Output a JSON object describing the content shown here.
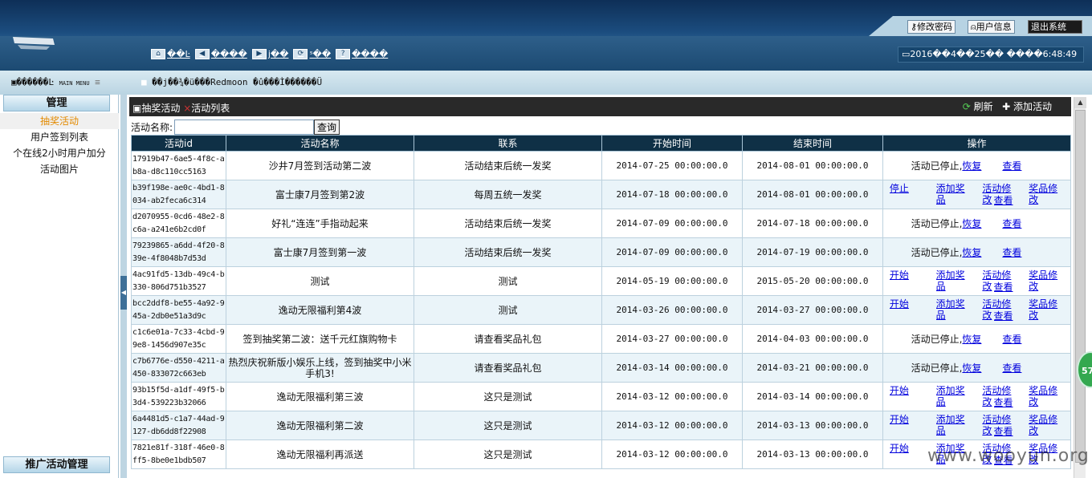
{
  "header": {
    "change_password": "修改密码",
    "user_info": "用户信息",
    "logout": "退出系统",
    "nav": [
      {
        "icon": "home-icon",
        "label": "��Ŀ"
      },
      {
        "icon": "back-icon",
        "label": "����"
      },
      {
        "icon": "forward-icon",
        "label": "j��"
      },
      {
        "icon": "refresh-icon",
        "label": "ˢ��"
      },
      {
        "icon": "help-icon",
        "label": "����"
      }
    ],
    "clock": "2016��4��25�� ����6:48:49"
  },
  "subheader": {
    "menu_title": "������Ŀ",
    "menu_sub": "MAIN MENU",
    "notice": "��j��¾�ü���Redmoon  �û���Ì������Ü"
  },
  "sidebar": {
    "section1": "管理",
    "items": [
      "抽奖活动",
      "用户签到列表",
      "个在线2小时用户加分",
      "活动图片"
    ],
    "section2": "推广活动管理"
  },
  "main": {
    "breadcrumb_module": "抽奖活动",
    "breadcrumb_page": "活动列表",
    "refresh": "刷新",
    "add": "添加活动",
    "search_label": "活动名称:",
    "search_value": "",
    "search_button": "查询",
    "columns": [
      "活动id",
      "活动名称",
      "联系",
      "开始时间",
      "结束时间",
      "操作"
    ],
    "rows": [
      {
        "id": "17919b47-6ae5-4f8c-ab8a-d8c110cc5163",
        "name": "沙井7月签到活动第二波",
        "contact": "活动结束后统一发奖",
        "start": "2014-07-25 00:00:00.0",
        "end": "2014-08-01 00:00:00.0",
        "status": "活动已停止,",
        "ops": [
          "恢复",
          "查看"
        ]
      },
      {
        "id": "b39f198e-ae0c-4bd1-8034-ab2feca6c314",
        "name": "富士康7月签到第2波",
        "contact": "每周五统一发奖",
        "start": "2014-07-18 00:00:00.0",
        "end": "2014-08-01 00:00:00.0",
        "status": "",
        "ops": [
          "停止",
          "添加奖品",
          "活动修改",
          "奖品修改",
          "查看"
        ]
      },
      {
        "id": "d2070955-0cd6-48e2-8c6a-a241e6b2cd0f",
        "name": "好礼“连连”手指动起来",
        "contact": "活动结束后统一发奖",
        "start": "2014-07-09 00:00:00.0",
        "end": "2014-07-18 00:00:00.0",
        "status": "活动已停止,",
        "ops": [
          "恢复",
          "查看"
        ]
      },
      {
        "id": "79239865-a6dd-4f20-839e-4f8048b7d53d",
        "name": "富士康7月签到第一波",
        "contact": "活动结束后统一发奖",
        "start": "2014-07-09 00:00:00.0",
        "end": "2014-07-19 00:00:00.0",
        "status": "活动已停止,",
        "ops": [
          "恢复",
          "查看"
        ]
      },
      {
        "id": "4ac91fd5-13db-49c4-b330-806d751b3527",
        "name": "测试",
        "contact": "测试",
        "start": "2014-05-19 00:00:00.0",
        "end": "2015-05-20 00:00:00.0",
        "status": "",
        "ops": [
          "开始",
          "添加奖品",
          "活动修改",
          "奖品修改",
          "查看"
        ]
      },
      {
        "id": "bcc2ddf8-be55-4a92-945a-2db0e51a3d9c",
        "name": "逸动无限福利第4波",
        "contact": "测试",
        "start": "2014-03-26 00:00:00.0",
        "end": "2014-03-27 00:00:00.0",
        "status": "",
        "ops": [
          "开始",
          "添加奖品",
          "活动修改",
          "奖品修改",
          "查看"
        ]
      },
      {
        "id": "c1c6e01a-7c33-4cbd-99e8-1456d907e35c",
        "name": "签到抽奖第二波：送千元红旗购物卡",
        "contact": "请查看奖品礼包",
        "start": "2014-03-27 00:00:00.0",
        "end": "2014-04-03 00:00:00.0",
        "status": "活动已停止,",
        "ops": [
          "恢复",
          "查看"
        ]
      },
      {
        "id": "c7b6776e-d550-4211-a450-833072c663eb",
        "name": "热烈庆祝新版小娱乐上线，签到抽奖中小米手机3!",
        "contact": "请查看奖品礼包",
        "start": "2014-03-14 00:00:00.0",
        "end": "2014-03-21 00:00:00.0",
        "status": "活动已停止,",
        "ops": [
          "恢复",
          "查看"
        ]
      },
      {
        "id": "93b15f5d-a1df-49f5-b3d4-539223b32066",
        "name": "逸动无限福利第三波",
        "contact": "这只是测试",
        "start": "2014-03-12 00:00:00.0",
        "end": "2014-03-14 00:00:00.0",
        "status": "",
        "ops": [
          "开始",
          "添加奖品",
          "活动修改",
          "奖品修改",
          "查看"
        ]
      },
      {
        "id": "6a4481d5-c1a7-44ad-9127-db6dd8f22908",
        "name": "逸动无限福利第二波",
        "contact": "这只是测试",
        "start": "2014-03-12 00:00:00.0",
        "end": "2014-03-13 00:00:00.0",
        "status": "",
        "ops": [
          "开始",
          "添加奖品",
          "活动修改",
          "奖品修改",
          "查看"
        ]
      },
      {
        "id": "7821e81f-318f-46e0-8ff5-8be0e1bdb507",
        "name": "逸动无限福利再派送",
        "contact": "这只是测试",
        "start": "2014-03-12 00:00:00.0",
        "end": "2014-03-13 00:00:00.0",
        "status": "",
        "ops": [
          "开始",
          "添加奖品",
          "活动修改",
          "奖品修改",
          "查看"
        ]
      }
    ]
  },
  "badge": "57",
  "watermark": "www.wooyun.org"
}
